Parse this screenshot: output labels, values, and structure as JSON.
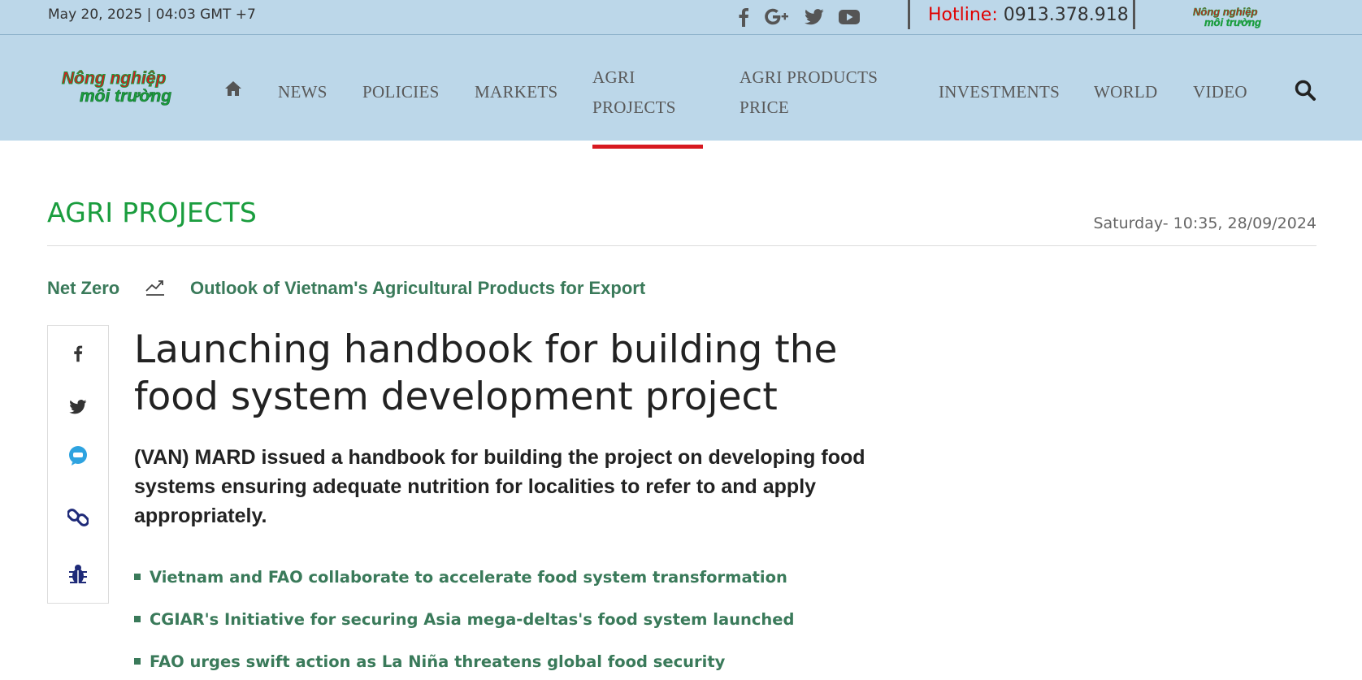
{
  "topbar": {
    "date": "May 20, 2025 | 04:03 GMT +7",
    "socials": [
      "facebook-icon",
      "google-plus-icon",
      "twitter-icon",
      "youtube-icon"
    ],
    "hotline_label": "Hotline:",
    "hotline_number": "0913.378.918"
  },
  "nav": {
    "logo_line1": "Nông nghiệp",
    "logo_line2": "môi trường",
    "items": [
      {
        "label": "NEWS"
      },
      {
        "label": "POLICIES"
      },
      {
        "label": "MARKETS"
      },
      {
        "label_line1": "AGRI",
        "label_line2": "PROJECTS",
        "active": true
      },
      {
        "label_line1": "AGRI PRODUCTS",
        "label_line2": "PRICE"
      },
      {
        "label": "INVESTMENTS"
      },
      {
        "label": "WORLD"
      },
      {
        "label": "VIDEO"
      }
    ]
  },
  "category": {
    "title": "AGRI PROJECTS",
    "published": "Saturday- 10:35, 28/09/2024"
  },
  "tags": [
    "Net Zero",
    "Outlook of Vietnam's Agricultural Products for Export"
  ],
  "share": [
    "facebook-icon",
    "twitter-icon",
    "zalo-icon",
    "link-icon",
    "bug-icon"
  ],
  "article": {
    "headline": "Launching handbook for building the food system development project",
    "sapo": "(VAN) MARD issued a handbook for building the project on developing food systems ensuring adequate nutrition for localities to refer to and apply appropriately.",
    "related": [
      "Vietnam and FAO collaborate to accelerate food system transformation",
      "CGIAR's Initiative for securing Asia mega-deltas's food system launched",
      "FAO urges swift action as La Niña threatens global food security"
    ]
  },
  "colors": {
    "header_bg": "#bcd7e9",
    "brand_green": "#1a9d3e",
    "link_green": "#3a7a5a",
    "active_red": "#d71920",
    "hotline_red": "#e00000"
  }
}
